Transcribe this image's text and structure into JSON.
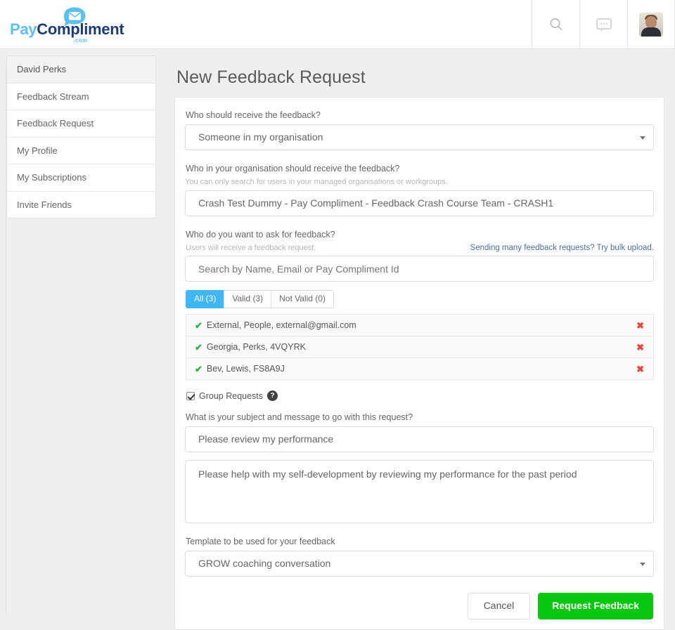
{
  "header": {
    "brand": {
      "pay": "Pay",
      "compliment": "Compliment",
      "dotcom": ".com"
    },
    "actions": [
      {
        "name": "search-icon",
        "label": "Search"
      },
      {
        "name": "messages-icon",
        "label": "Messages"
      },
      {
        "name": "avatar",
        "label": "Account"
      }
    ]
  },
  "sidebar": {
    "items": [
      {
        "label": "David Perks",
        "heading": true
      },
      {
        "label": "Feedback Stream",
        "heading": false
      },
      {
        "label": "Feedback Request",
        "heading": false
      },
      {
        "label": "My Profile",
        "heading": false
      },
      {
        "label": "My Subscriptions",
        "heading": false
      },
      {
        "label": "Invite Friends",
        "heading": false
      }
    ]
  },
  "main": {
    "title": "New Feedback Request",
    "recipient_type": {
      "label": "Who should receive the feedback?",
      "value": "Someone in my organisation"
    },
    "org_user": {
      "label": "Who in your organisation should receive the feedback?",
      "hint": "You can only search for users in your managed organisations or workgroups.",
      "value": "Crash Test Dummy - Pay Compliment - Feedback Crash Course Team - CRASH1"
    },
    "ask": {
      "label": "Who do you want to ask for feedback?",
      "hint": "Users will receive a feedback request.",
      "bulk_link": "Sending many feedback requests? Try bulk upload.",
      "search_placeholder": "Search by Name, Email or Pay Compliment Id",
      "search_value": ""
    },
    "tabs": [
      {
        "label": "All (3)",
        "active": true
      },
      {
        "label": "Valid (3)",
        "active": false
      },
      {
        "label": "Not Valid (0)",
        "active": false
      }
    ],
    "recipients": [
      {
        "name": "External, People, external@gmail.com",
        "valid": true,
        "remove": "✖"
      },
      {
        "name": "Georgia, Perks, 4VQYRK",
        "valid": true,
        "remove": "✖"
      },
      {
        "name": "Bev, Lewis, FS8A9J",
        "valid": true,
        "remove": "✖"
      }
    ],
    "group_requests": {
      "label": "Group Requests",
      "checked": true,
      "help": "?"
    },
    "message": {
      "label": "What is your subject and message to go with this request?",
      "subject": "Please review my performance",
      "body": "Please help with my self-development by reviewing my performance for the past period"
    },
    "template": {
      "label": "Template to be used for your feedback",
      "value": "GROW coaching conversation"
    },
    "buttons": {
      "cancel": "Cancel",
      "submit": "Request Feedback"
    }
  },
  "colors": {
    "brand_light": "#5bc0f0",
    "brand_dark": "#1b3a77",
    "tab_active": "#41b6f5",
    "link": "#4a6fa8",
    "valid": "#2fae45",
    "remove": "#e8463a",
    "primary": "#0ac80f"
  }
}
